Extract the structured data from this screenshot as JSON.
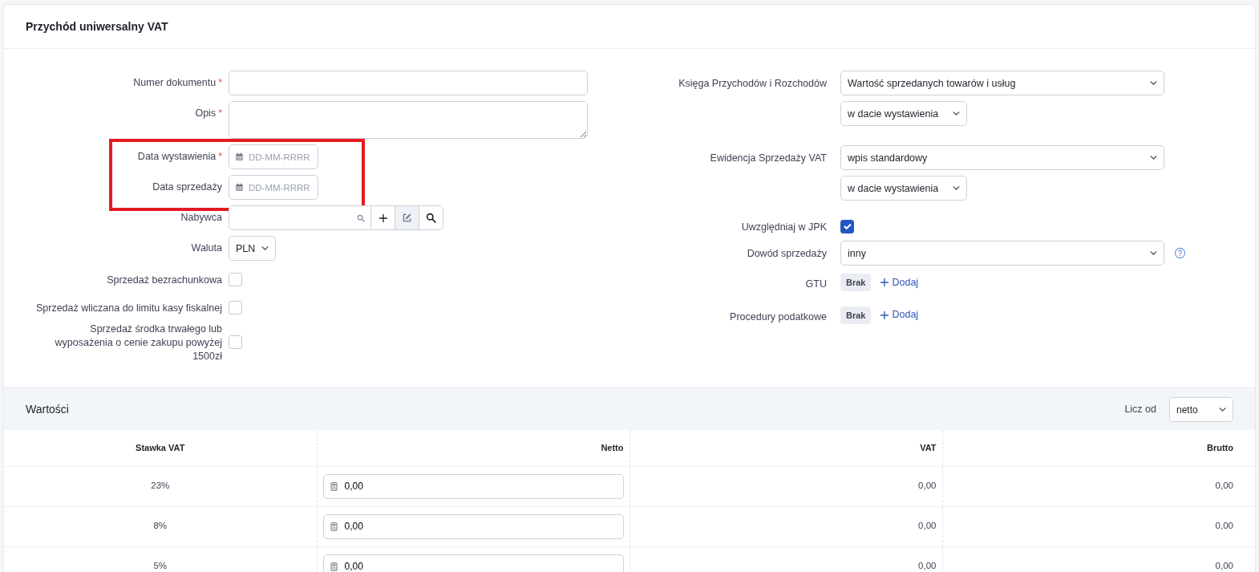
{
  "card": {
    "title": "Przychód uniwersalny VAT"
  },
  "left_fields": [
    {
      "kind": "text",
      "label": "Numer dokumentu",
      "required_mark": "*",
      "highlighted": false
    },
    {
      "kind": "textarea",
      "label": "Opis",
      "required_mark": "*",
      "highlighted": false
    },
    {
      "kind": "date",
      "label": "Data wystawienia",
      "required_mark": "*",
      "placeholder": "DD-MM-RRRR",
      "highlighted": true
    },
    {
      "kind": "date",
      "label": "Data sprzedaży",
      "placeholder": "DD-MM-RRRR",
      "highlighted": true
    },
    {
      "kind": "search",
      "label": "Nabywca",
      "highlighted": false
    },
    {
      "kind": "select",
      "label": "Waluta",
      "value": "PLN",
      "highlighted": false
    },
    {
      "kind": "checkbox",
      "label": "Sprzedaż bezrachunkowa",
      "checked": false,
      "highlighted": false
    },
    {
      "kind": "checkbox",
      "label": "Sprzedaż wliczana do limitu kasy fiskalnej",
      "checked": false,
      "highlighted": false
    },
    {
      "kind": "checkbox",
      "label": "Sprzedaż środka trwałego lub wyposażenia o cenie zakupu powyżej 1500zł",
      "checked": false,
      "highlighted": false
    }
  ],
  "right_fields": [
    {
      "kind": "select-pair",
      "label": "Księga Przychodów i Rozchodów",
      "value": "Wartość sprzedanych towarów i usług",
      "second_value": "w dacie wystawienia"
    },
    {
      "kind": "select-pair",
      "label": "Ewidencja Sprzedaży VAT",
      "value": "wpis standardowy",
      "second_value": "w dacie wystawienia"
    },
    {
      "kind": "checkbox",
      "label": "Uwzględniaj w JPK",
      "checked": true
    },
    {
      "kind": "select",
      "label": "Dowód sprzedaży",
      "value": "inny",
      "help": true
    },
    {
      "kind": "tags",
      "label": "GTU",
      "tag": "Brak",
      "action": "Dodaj"
    },
    {
      "kind": "tags",
      "label": "Procedury podatkowe",
      "tag": "Brak",
      "action": "Dodaj"
    }
  ],
  "values": {
    "title": "Wartości",
    "count_from_label": "Licz od",
    "count_from": "netto",
    "columns": [
      "Stawka VAT",
      "Netto",
      "VAT",
      "Brutto"
    ],
    "rows": [
      {
        "rate": "23%",
        "net": "0,00",
        "vat": "0,00",
        "gross": "0,00"
      },
      {
        "rate": "8%",
        "net": "0,00",
        "vat": "0,00",
        "gross": "0,00"
      },
      {
        "rate": "5%",
        "net": "0,00",
        "vat": "0,00",
        "gross": "0,00"
      }
    ]
  }
}
